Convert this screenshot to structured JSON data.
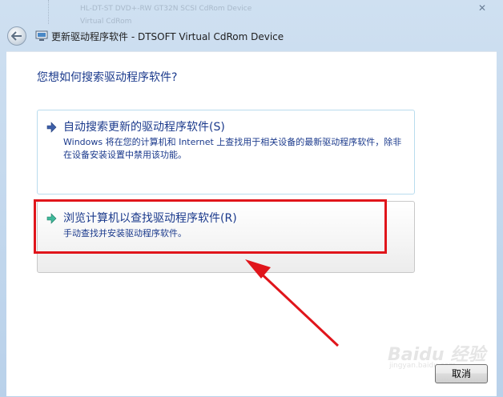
{
  "background_window": {
    "row1": "HL-DT-ST DVD+-RW GT32N SCSI CdRom Device",
    "row2": "Virtual CdRom"
  },
  "window": {
    "title": "更新驱动程序软件 - DTSOFT Virtual CdRom Device"
  },
  "main": {
    "question": "您想如何搜索驱动程序软件?",
    "options": [
      {
        "title": "自动搜索更新的驱动程序软件(S)",
        "description": "Windows 将在您的计算机和 Internet 上查找用于相关设备的最新驱动程序软件，除非在设备安装设置中禁用该功能。"
      },
      {
        "title": "浏览计算机以查找驱动程序软件(R)",
        "description": "手动查找并安装驱动程序软件。"
      }
    ]
  },
  "footer": {
    "cancel_label": "取消"
  },
  "watermark": {
    "brand": "Baidu 经验",
    "url": "jingyan.baidu.com"
  },
  "colors": {
    "link_blue": "#1b3a8c",
    "annotation_red": "#e0151b",
    "option_border": "#b9dcee"
  },
  "icons": {
    "back": "back-arrow-icon",
    "title": "device-manager-icon",
    "option": "green-arrow-icon",
    "close": "close-icon"
  }
}
